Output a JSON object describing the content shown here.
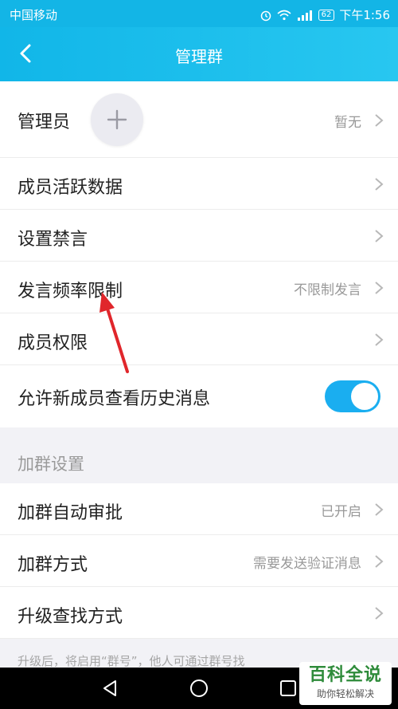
{
  "status": {
    "carrier": "中国移动",
    "battery": "62",
    "time": "下午1:56"
  },
  "header": {
    "title": "管理群"
  },
  "rows": {
    "admin": {
      "label": "管理员",
      "value": "暂无"
    },
    "activity": {
      "label": "成员活跃数据"
    },
    "mute": {
      "label": "设置禁言"
    },
    "rate": {
      "label": "发言频率限制",
      "value": "不限制发言"
    },
    "perms": {
      "label": "成员权限"
    },
    "history": {
      "label": "允许新成员查看历史消息",
      "enabled": true
    }
  },
  "join_section": {
    "title": "加群设置",
    "auto_approve": {
      "label": "加群自动审批",
      "value": "已开启"
    },
    "method": {
      "label": "加群方式",
      "value": "需要发送验证消息"
    },
    "upgrade": {
      "label": "升级查找方式"
    }
  },
  "footer_note": "升级后，将启用“群号”，他人可通过群号找",
  "watermark": {
    "line1": "百科全说",
    "line2": "助你轻松解决"
  },
  "colors": {
    "accent": "#13b5e6",
    "toggle_on": "#1aaef0",
    "annotation_arrow": "#e0262b"
  }
}
